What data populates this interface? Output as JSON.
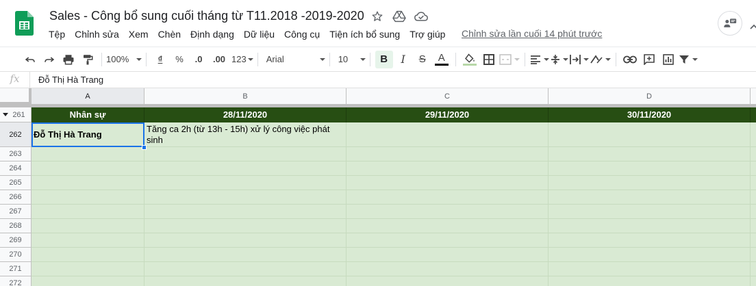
{
  "document": {
    "title": "Sales - Công bổ sung cuối tháng từ T11.2018 -2019-2020",
    "last_edit": "Chỉnh sửa lần cuối 14 phút trước"
  },
  "menu": [
    "Tệp",
    "Chỉnh sửa",
    "Xem",
    "Chèn",
    "Định dạng",
    "Dữ liệu",
    "Công cụ",
    "Tiện ích bổ sung",
    "Trợ giúp"
  ],
  "toolbar": {
    "zoom": "100%",
    "currency": "₫",
    "percent": "%",
    "dec_decrease": ".0",
    "dec_increase": ".00",
    "more_formats": "123",
    "font": "Arial",
    "font_size": "10",
    "bold": "B",
    "italic": "I",
    "strike": "S",
    "text_color_letter": "A",
    "text_color": "#000000",
    "fill_color": "#d9ead3"
  },
  "formula_bar": {
    "fx": "fx",
    "value": "Đỗ Thị Hà Trang"
  },
  "sheet": {
    "columns": [
      "A",
      "B",
      "C",
      "D"
    ],
    "rows": [
      "261",
      "262",
      "263",
      "264",
      "265",
      "266",
      "267",
      "268",
      "269",
      "270",
      "271",
      "272"
    ],
    "header": [
      "Nhân sự",
      "28/11/2020",
      "29/11/2020",
      "30/11/2020"
    ],
    "cells": {
      "a262": "Đỗ Thị Hà Trang",
      "b262": "Tăng ca 2h (từ 13h - 15h) xử lý công việc phát sinh"
    },
    "selected_cell": "A262",
    "header_fill": "#274e13",
    "body_fill": "#d9ead3"
  }
}
